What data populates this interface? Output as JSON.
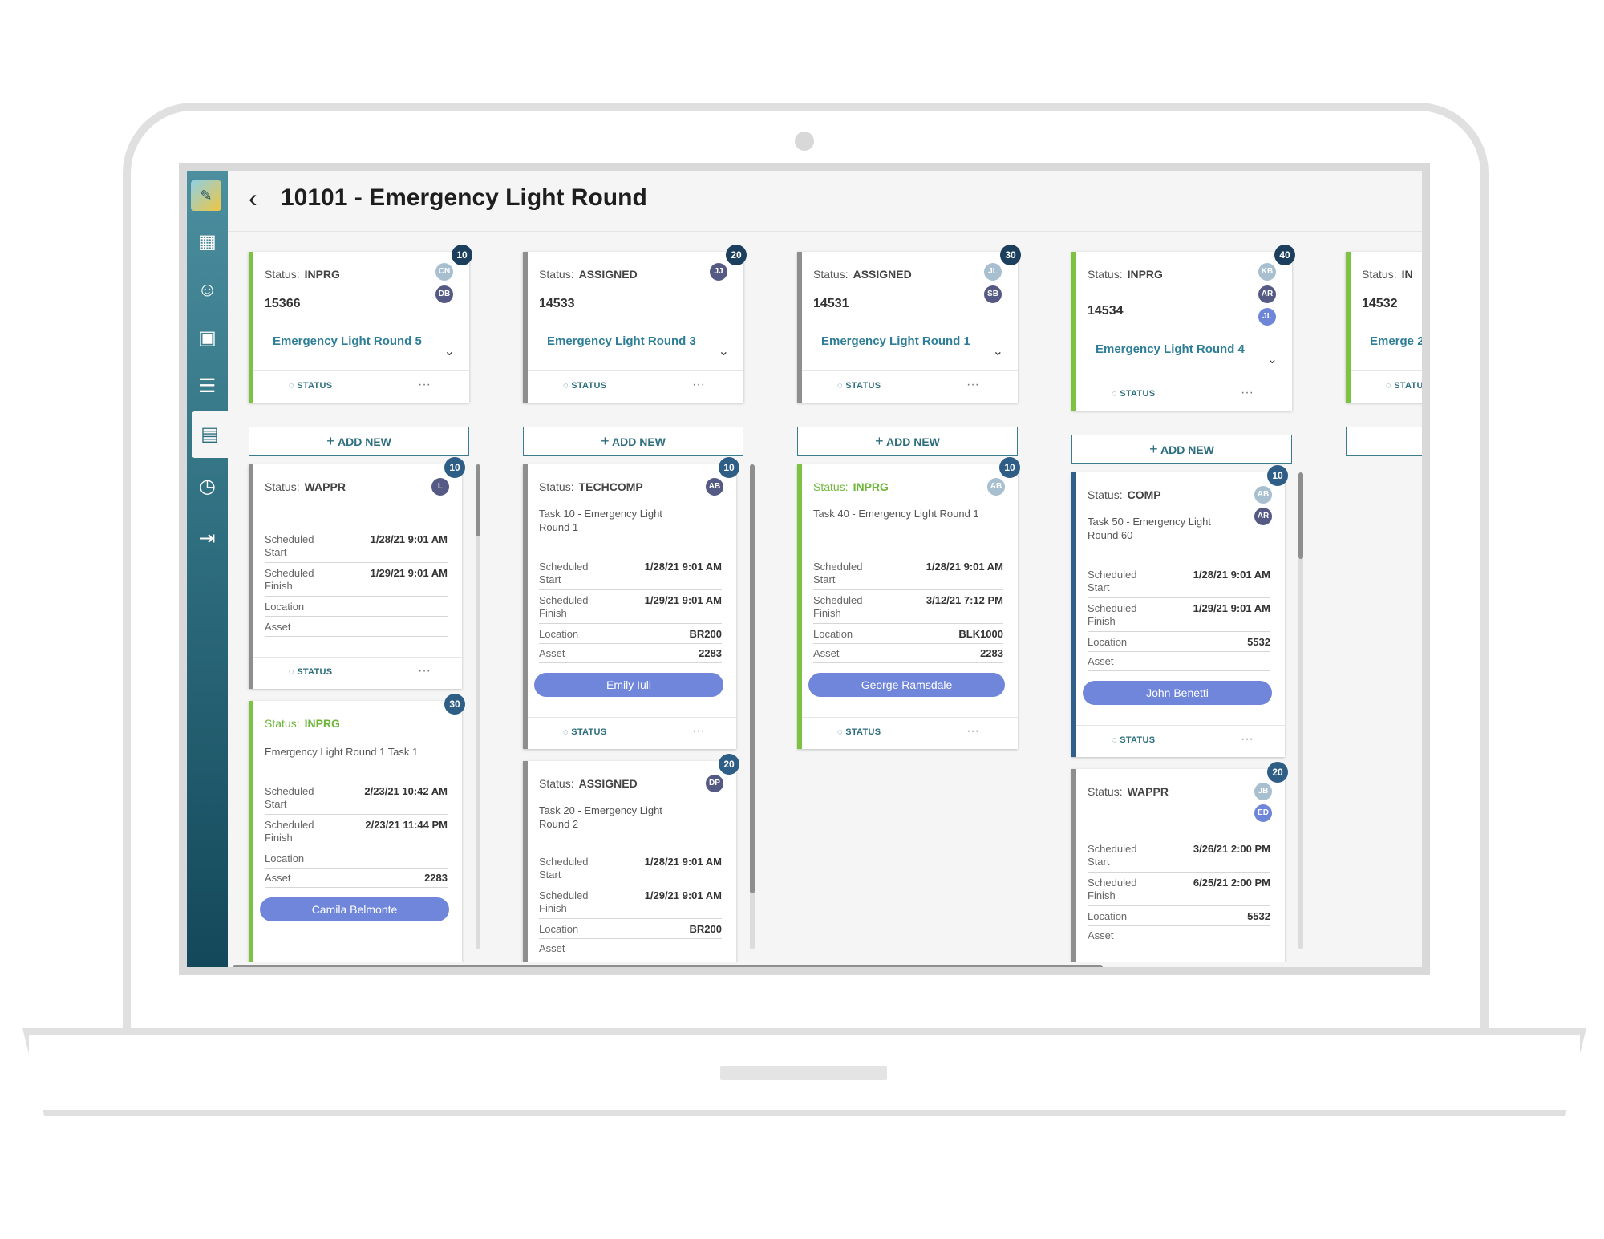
{
  "title": "10101 - Emergency Light Round",
  "add_new_label": "ADD NEW",
  "status_label": "STATUS",
  "status_prefix": "Status:",
  "more_label": "···",
  "field_labels": {
    "scheduled_start": "Scheduled Start",
    "scheduled_finish": "Scheduled Finish",
    "location": "Location",
    "asset": "Asset"
  },
  "columns": [
    {
      "header": {
        "badge": "10",
        "status": "INPRG",
        "number": "15366",
        "title": "Emergency Light Round 5",
        "avatars": [
          "CN",
          "DB"
        ]
      },
      "cards": [
        {
          "badge": "10",
          "status": "WAPPR",
          "avatars": [
            "L"
          ],
          "desc": "",
          "start": "1/28/21 9:01 AM",
          "finish": "1/29/21 9:01 AM",
          "location": "",
          "asset": ""
        },
        {
          "badge": "30",
          "status": "INPRG",
          "avatars": [],
          "desc": "Emergency Light Round 1 Task 1",
          "start": "2/23/21 10:42 AM",
          "finish": "2/23/21 11:44 PM",
          "location": "",
          "asset": "2283",
          "person": "Camila Belmonte"
        }
      ]
    },
    {
      "header": {
        "badge": "20",
        "status": "ASSIGNED",
        "number": "14533",
        "title": "Emergency Light Round 3",
        "avatars": [
          "JJ"
        ]
      },
      "cards": [
        {
          "badge": "10",
          "status": "TECHCOMP",
          "avatars": [
            "AB"
          ],
          "desc": "Task 10 - Emergency Light Round 1",
          "start": "1/28/21 9:01 AM",
          "finish": "1/29/21 9:01 AM",
          "location": "BR200",
          "asset": "2283",
          "person": "Emily Iuli"
        },
        {
          "badge": "20",
          "status": "ASSIGNED",
          "avatars": [
            "DP"
          ],
          "desc": "Task 20 - Emergency Light Round 2",
          "start": "1/28/21 9:01 AM",
          "finish": "1/29/21 9:01 AM",
          "location": "BR200",
          "asset": ""
        }
      ]
    },
    {
      "header": {
        "badge": "30",
        "status": "ASSIGNED",
        "number": "14531",
        "title": "Emergency Light Round 1",
        "avatars": [
          "JL",
          "SB"
        ]
      },
      "cards": [
        {
          "badge": "10",
          "status": "INPRG",
          "avatars": [
            "AB"
          ],
          "desc": "Task 40 - Emergency Light Round 1",
          "start": "1/28/21 9:01 AM",
          "finish": "3/12/21 7:12 PM",
          "location": "BLK1000",
          "asset": "2283",
          "person": "George Ramsdale"
        }
      ]
    },
    {
      "header": {
        "badge": "40",
        "status": "INPRG",
        "number": "14534",
        "title": "Emergency Light Round 4",
        "avatars": [
          "KB",
          "AR",
          "JL"
        ]
      },
      "cards": [
        {
          "badge": "10",
          "status": "COMP",
          "avatars": [
            "AB",
            "AR"
          ],
          "desc": "Task 50 - Emergency Light Round 60",
          "start": "1/28/21 9:01 AM",
          "finish": "1/29/21 9:01 AM",
          "location": "5532",
          "asset": "",
          "person": "John Benetti"
        },
        {
          "badge": "20",
          "status": "WAPPR",
          "avatars": [
            "JB",
            "ED"
          ],
          "desc": "",
          "start": "3/26/21 2:00 PM",
          "finish": "6/25/21 2:00 PM",
          "location": "5532",
          "asset": ""
        }
      ]
    },
    {
      "header": {
        "status": "IN",
        "number": "14532",
        "title": "Emerge 2"
      }
    }
  ]
}
